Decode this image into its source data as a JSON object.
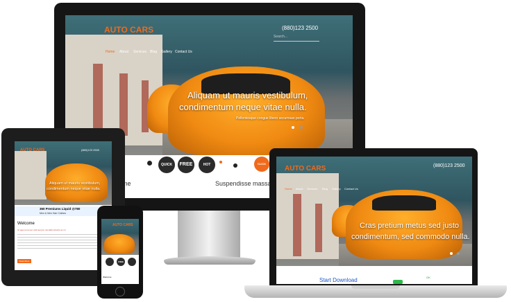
{
  "brand": {
    "name": "AUTO CARS",
    "phone": "(880)123 2500",
    "search_placeholder": "Search..."
  },
  "nav": {
    "items": [
      "Home",
      "About",
      "Services",
      "Blog",
      "Gallery",
      "Contact Us"
    ]
  },
  "desktop": {
    "hero_line1": "Aliquam ut mauris vestibulum,",
    "hero_line2": "condimentum neque vitae nulla.",
    "hero_sub": "Pellentesque congue libero accumsan porta.",
    "badge_free": "FREE",
    "badge_quick": "QUICK",
    "badge_hot": "HOT",
    "badge_offer": "CLICK HERE",
    "strip_left": "me",
    "strip_right": "Suspendisse massa"
  },
  "tablet": {
    "hero_line1": "Aliquam ut mauris vestibulum,",
    "hero_line2": "condimentum neque vitae nulla.",
    "promo": "360 Premiums Liquid  @780",
    "promo_sub": "Men & Men Hair Clothes",
    "welcome": "Welcome",
    "welcome_sub": "Ut eget urna nec velit tempor convallis lobortis ac mi.",
    "button": "Read More"
  },
  "laptop": {
    "hero_line1": "Cras pretium metus sed justo",
    "hero_line2": "condimentum, sed commodo nulla.",
    "footer_link": "Start Download",
    "ok": "OK"
  },
  "phone": {
    "badge_free": "FREE",
    "welcome": "Welcome"
  },
  "colors": {
    "accent": "#f06a1c",
    "bezel": "#1a1a1a",
    "sky": "#3f6f78"
  }
}
